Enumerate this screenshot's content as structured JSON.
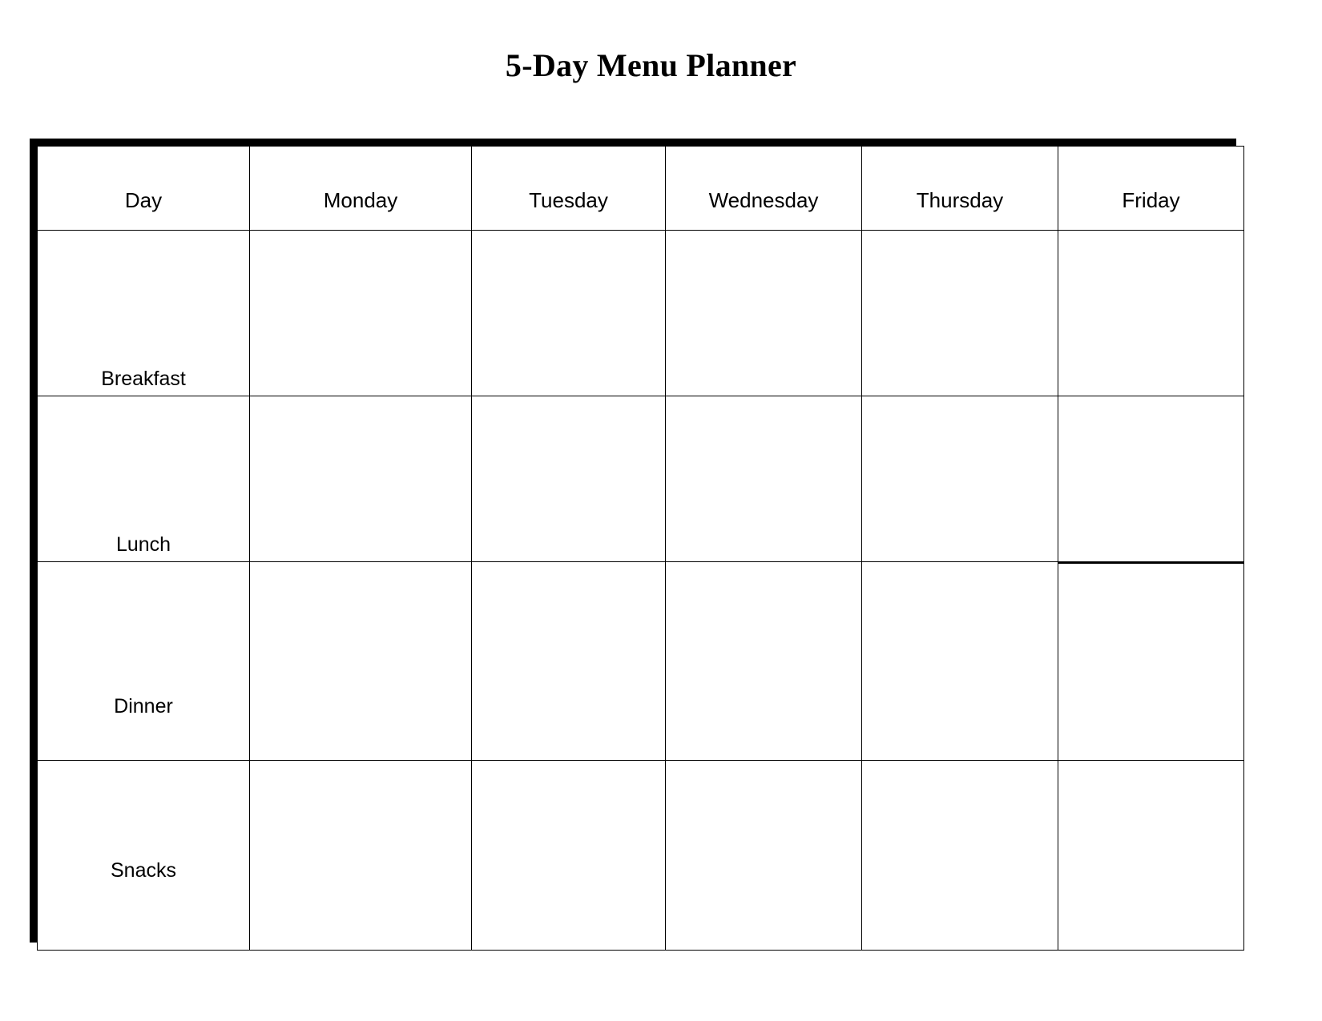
{
  "document": {
    "title": "5-Day Menu Planner"
  },
  "table": {
    "headers": [
      "Day",
      "Monday",
      "Tuesday",
      "Wednesday",
      "Thursday",
      "Friday"
    ],
    "rows": [
      {
        "label": "Breakfast",
        "cells": [
          "",
          "",
          "",
          "",
          ""
        ]
      },
      {
        "label": "Lunch",
        "cells": [
          "",
          "",
          "",
          "",
          ""
        ]
      },
      {
        "label": "Dinner",
        "cells": [
          "",
          "",
          "",
          "",
          ""
        ]
      },
      {
        "label": "Snacks",
        "cells": [
          "",
          "",
          "",
          "",
          ""
        ]
      }
    ]
  },
  "style": {
    "border_color": "#000000",
    "background_color": "#ffffff",
    "text_color": "#000000"
  }
}
